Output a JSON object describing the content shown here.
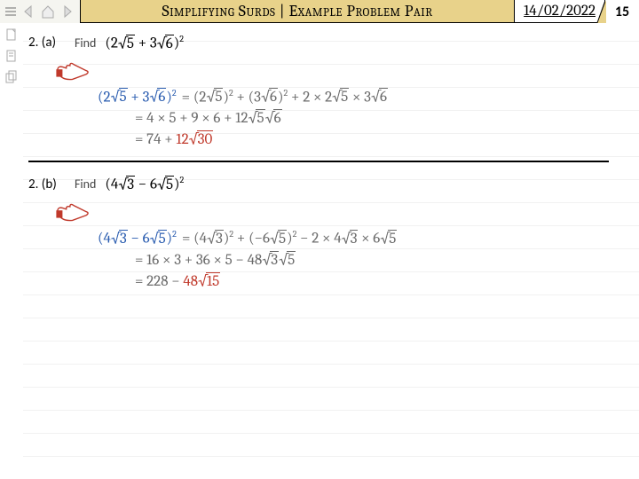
{
  "header": {
    "title": "Simplifying Surds | Example Problem Pair",
    "date": "14/02/2022",
    "page_number": "15"
  },
  "problem_a": {
    "label": "2. (a)",
    "instruction": "Find",
    "expression": "(2√5 + 3√6)²",
    "steps": {
      "expand_lhs": "(2√5 + 3√6)²",
      "expand_rhs": " = (2√5)² + (3√6)² + 2 × 2√5 × 3√6",
      "step2": " = 4 × 5 + 9 × 6 + 12√5√6",
      "step3_black": " = 74 + ",
      "step3_red": "12√30"
    }
  },
  "problem_b": {
    "label": "2. (b)",
    "instruction": "Find",
    "expression": "(4√3 − 6√5)²",
    "steps": {
      "expand_lhs": "(4√3 − 6√5)²",
      "expand_rhs": " = (4√3)² + (−6√5)² − 2 × 4√3 × 6√5",
      "step2": " = 16 × 3 + 36 × 5 − 48√3√5",
      "step3_black": " = 228 − ",
      "step3_red": "48√15"
    }
  }
}
